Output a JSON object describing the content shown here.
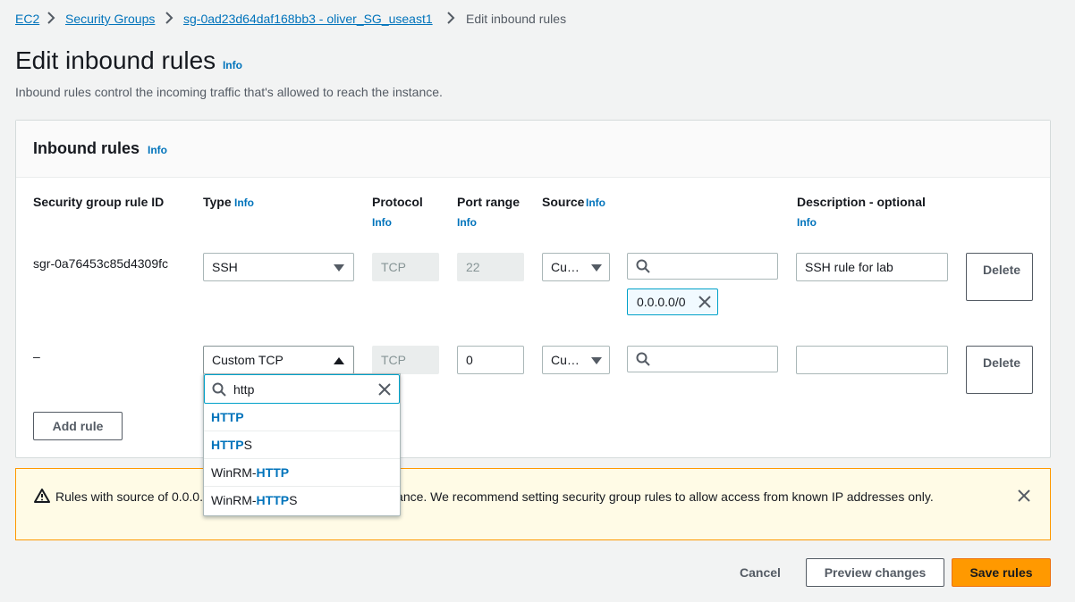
{
  "breadcrumb": {
    "items": [
      "EC2",
      "Security Groups",
      "sg-0ad23d64daf168bb3 - oliver_SG_useast1"
    ],
    "current": "Edit inbound rules"
  },
  "page": {
    "title": "Edit inbound rules",
    "info": "Info",
    "description": "Inbound rules control the incoming traffic that's allowed to reach the instance."
  },
  "panel": {
    "title": "Inbound rules",
    "info": "Info",
    "columns": {
      "rule_id": "Security group rule ID",
      "type": "Type",
      "protocol": "Protocol",
      "port_range": "Port range",
      "source": "Source",
      "description": "Description - optional",
      "info": "Info"
    },
    "rows": [
      {
        "rule_id": "sgr-0a76453c85d4309fc",
        "type": "SSH",
        "protocol": "TCP",
        "port_range": "22",
        "source_type": "Cu…",
        "source_search": "",
        "token": "0.0.0.0/0",
        "description": "SSH rule for lab",
        "delete": "Delete"
      },
      {
        "rule_id": "–",
        "type": "Custom TCP",
        "protocol": "TCP",
        "port_range": "0",
        "source_type": "Cu…",
        "source_search": "",
        "description": "",
        "delete": "Delete"
      }
    ],
    "add_rule": "Add rule"
  },
  "dropdown": {
    "query": "http",
    "options": [
      {
        "prefix": "",
        "match": "HTTP",
        "suffix": ""
      },
      {
        "prefix": "",
        "match": "HTTP",
        "suffix": "S"
      },
      {
        "prefix": "WinRM-",
        "match": "HTTP",
        "suffix": ""
      },
      {
        "prefix": "WinRM-",
        "match": "HTTP",
        "suffix": "S"
      }
    ]
  },
  "alert": {
    "text_before": "Rules with source of 0.0.0.",
    "text_after": "o access your instance. We recommend setting security group rules to allow access from known IP addresses only."
  },
  "footer": {
    "cancel": "Cancel",
    "preview": "Preview changes",
    "save": "Save rules"
  },
  "colors": {
    "link": "#0073bb",
    "primary": "#ff9900",
    "warning_bg": "#fffbe6",
    "token_border": "#00a1c9"
  }
}
